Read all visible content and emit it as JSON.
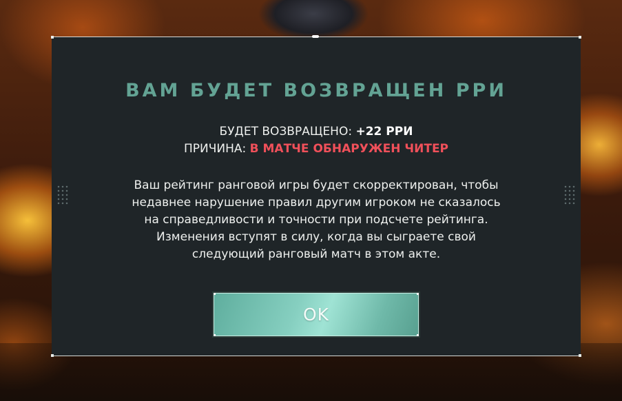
{
  "dialog": {
    "title": "ВАМ БУДЕТ ВОЗВРАЩЕН РРИ",
    "refund": {
      "label": "БУДЕТ ВОЗВРАЩЕНО: ",
      "value": "+22 РРИ"
    },
    "reason": {
      "label": "ПРИЧИНА: ",
      "value": "В МАТЧЕ ОБНАРУЖЕН ЧИТЕР"
    },
    "body_lines": [
      "Ваш рейтинг ранговой игры будет скорректирован, чтобы",
      "недавнее нарушение правил другим игроком не сказалось",
      "на справедливости и точности при подсчете рейтинга.",
      "Изменения вступят в силу, когда вы сыграете свой",
      "следующий ранговый матч в этом акте."
    ],
    "ok_label": "OK"
  },
  "colors": {
    "title": "#63a394",
    "reason_value": "#f0505a",
    "modal_bg": "#1f2528",
    "button_accent": "#86cfc0"
  }
}
